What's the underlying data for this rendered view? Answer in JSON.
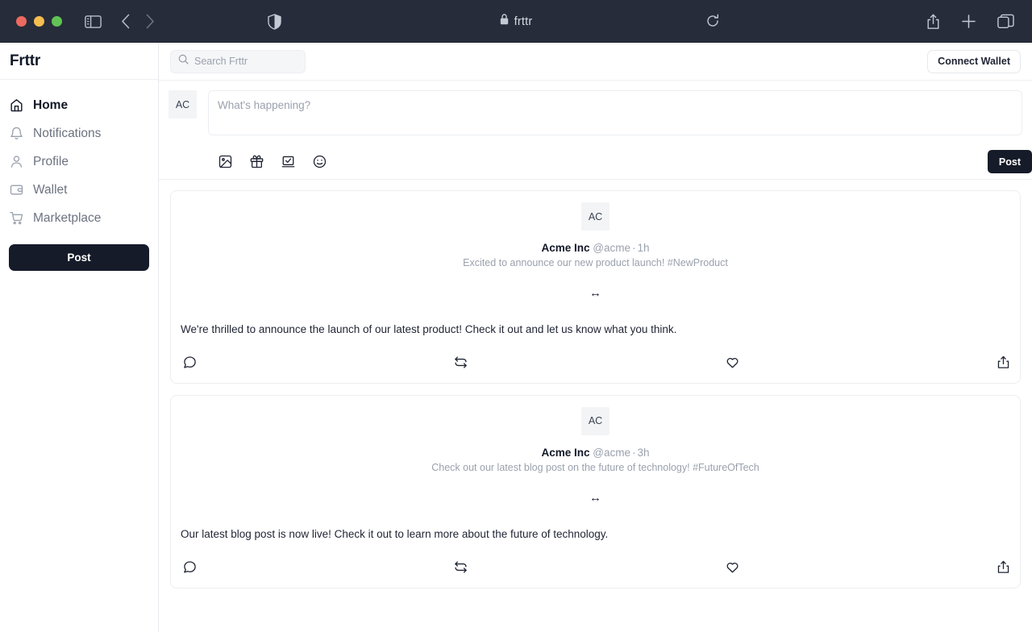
{
  "browser": {
    "traffic_lights": [
      "close",
      "minimize",
      "zoom"
    ],
    "sidebar_toggle_icon": "sidebar-toggle-icon",
    "back_icon": "chevron-left-icon",
    "forward_icon": "chevron-right-icon",
    "shield_icon": "privacy-shield-icon",
    "lock_icon": "lock-icon",
    "url": "frttr",
    "reload_icon": "reload-icon",
    "share_icon": "share-icon",
    "new_tab_icon": "plus-icon",
    "tabs_icon": "tab-overview-icon"
  },
  "sidebar": {
    "brand": "Frttr",
    "items": [
      {
        "label": "Home",
        "icon": "home-icon",
        "active": true
      },
      {
        "label": "Notifications",
        "icon": "bell-icon",
        "active": false
      },
      {
        "label": "Profile",
        "icon": "person-icon",
        "active": false
      },
      {
        "label": "Wallet",
        "icon": "wallet-icon",
        "active": false
      },
      {
        "label": "Marketplace",
        "icon": "cart-icon",
        "active": false
      }
    ],
    "post_button": "Post"
  },
  "topbar": {
    "search_placeholder": "Search Frttr",
    "search_value": "",
    "search_icon": "search-icon",
    "connect_wallet": "Connect Wallet"
  },
  "composer": {
    "avatar_initials": "AC",
    "placeholder": "What's happening?",
    "value": "",
    "actions": [
      {
        "icon": "image-icon"
      },
      {
        "icon": "gift-icon"
      },
      {
        "icon": "poll-icon"
      },
      {
        "icon": "emoji-icon"
      }
    ],
    "post_button": "Post"
  },
  "feed": {
    "posts": [
      {
        "avatar_initials": "AC",
        "display_name": "Acme Inc",
        "handle": "@acme",
        "separator": "·",
        "timestamp": "1h",
        "subtitle": "Excited to announce our new product launch! #NewProduct",
        "media_placeholder": "↔",
        "body": "We're thrilled to announce the launch of our latest product! Check it out and let us know what you think.",
        "actions": [
          {
            "icon": "comment-icon"
          },
          {
            "icon": "repost-icon"
          },
          {
            "icon": "like-icon"
          },
          {
            "icon": "share-icon"
          }
        ]
      },
      {
        "avatar_initials": "AC",
        "display_name": "Acme Inc",
        "handle": "@acme",
        "separator": "·",
        "timestamp": "3h",
        "subtitle": "Check out our latest blog post on the future of technology! #FutureOfTech",
        "media_placeholder": "↔",
        "body": "Our latest blog post is now live! Check it out to learn more about the future of technology.",
        "actions": [
          {
            "icon": "comment-icon"
          },
          {
            "icon": "repost-icon"
          },
          {
            "icon": "like-icon"
          },
          {
            "icon": "share-icon"
          }
        ]
      }
    ]
  },
  "colors": {
    "chrome_bg": "#272c3a",
    "accent_dark": "#161b29",
    "text_primary": "#111827",
    "text_muted": "#9aa1ad",
    "border": "#eceef1"
  }
}
